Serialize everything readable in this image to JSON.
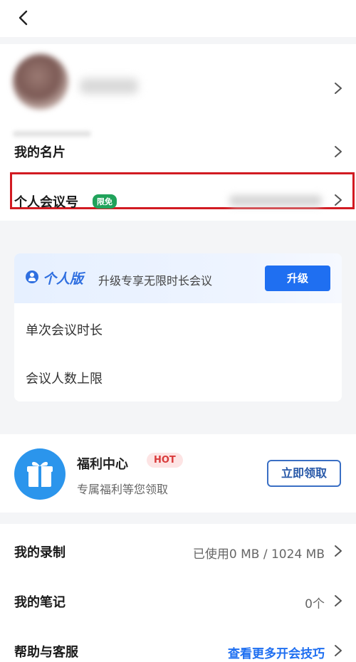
{
  "nav": {
    "back_icon": "chevron-left-icon"
  },
  "profile": {
    "avatar_icon": "avatar",
    "rows": [
      {
        "label": "我的名片"
      },
      {
        "label": "个人会议号",
        "badge": "限免"
      }
    ]
  },
  "vip": {
    "title": "个人版",
    "description": "升级专享无限时长会议",
    "upgrade_label": "升级",
    "items": [
      {
        "label": "单次会议时长"
      },
      {
        "label": "会议人数上限"
      }
    ]
  },
  "welfare": {
    "title": "福利中心",
    "hot_badge": "HOT",
    "subtitle": "专属福利等您领取",
    "claim_label": "立即领取"
  },
  "list": [
    {
      "label": "我的录制",
      "value": "已使用0 MB / 1024 MB"
    },
    {
      "label": "我的笔记",
      "value": "0个"
    },
    {
      "label": "帮助与客服",
      "value": "查看更多开会技巧"
    }
  ],
  "colors": {
    "accent": "#1f6ff1",
    "badge_green": "#20a35b",
    "highlight_red": "#d21b22",
    "hot_red": "#d93b3b"
  }
}
